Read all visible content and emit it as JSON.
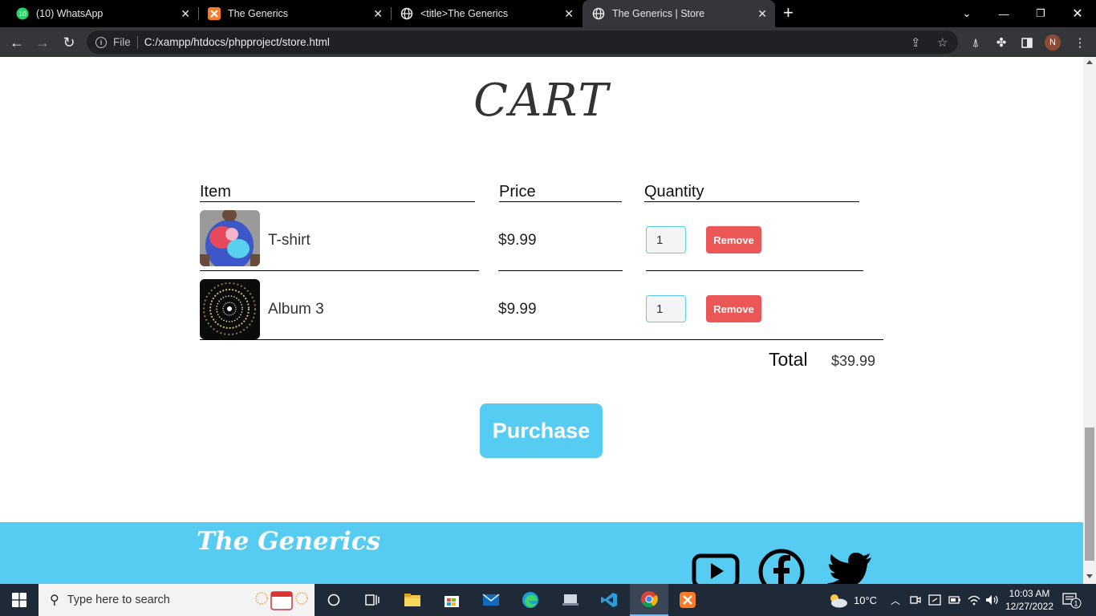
{
  "browser": {
    "tabs": [
      {
        "title": "(10) WhatsApp",
        "badge": "10",
        "icon": "whatsapp-icon"
      },
      {
        "title": "The Generics",
        "icon": "xampp-icon"
      },
      {
        "title": "<title>The Generics",
        "icon": "globe-icon"
      },
      {
        "title": "The Generics | Store",
        "icon": "globe-icon",
        "active": true
      }
    ],
    "address_scheme": "File",
    "address_url": "C:/xampp/htdocs/phpproject/store.html",
    "profile_initial": "N"
  },
  "page": {
    "cart_title": "CART",
    "columns": {
      "item": "Item",
      "price": "Price",
      "quantity": "Quantity"
    },
    "items": [
      {
        "name": "T-shirt",
        "price": "$9.99",
        "quantity": "1",
        "remove_label": "Remove"
      },
      {
        "name": "Album 3",
        "price": "$9.99",
        "quantity": "1",
        "remove_label": "Remove"
      }
    ],
    "total_label": "Total",
    "total_value": "$39.99",
    "purchase_label": "Purchase",
    "footer_brand": "The Generics",
    "colors": {
      "accent": "#56ccf2",
      "danger": "#eb5757"
    }
  },
  "taskbar": {
    "search_placeholder": "Type here to search",
    "weather": "10°C",
    "time": "10:03 AM",
    "date": "12/27/2022",
    "notification_count": "1"
  }
}
